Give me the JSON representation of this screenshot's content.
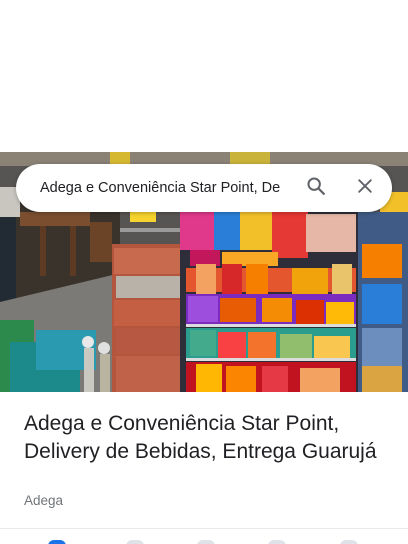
{
  "search": {
    "query": "Adega e Conveniência Star Point, De",
    "search_icon": "search-icon",
    "close_icon": "close-icon"
  },
  "place": {
    "title": "Adega e Conveniência Star Point, Delivery de Bebidas, Entrega Guarujá",
    "category": "Adega"
  },
  "colors": {
    "title": "#202124",
    "category": "#70757a",
    "accent": "#1a73e8",
    "icon": "#5f6368"
  }
}
